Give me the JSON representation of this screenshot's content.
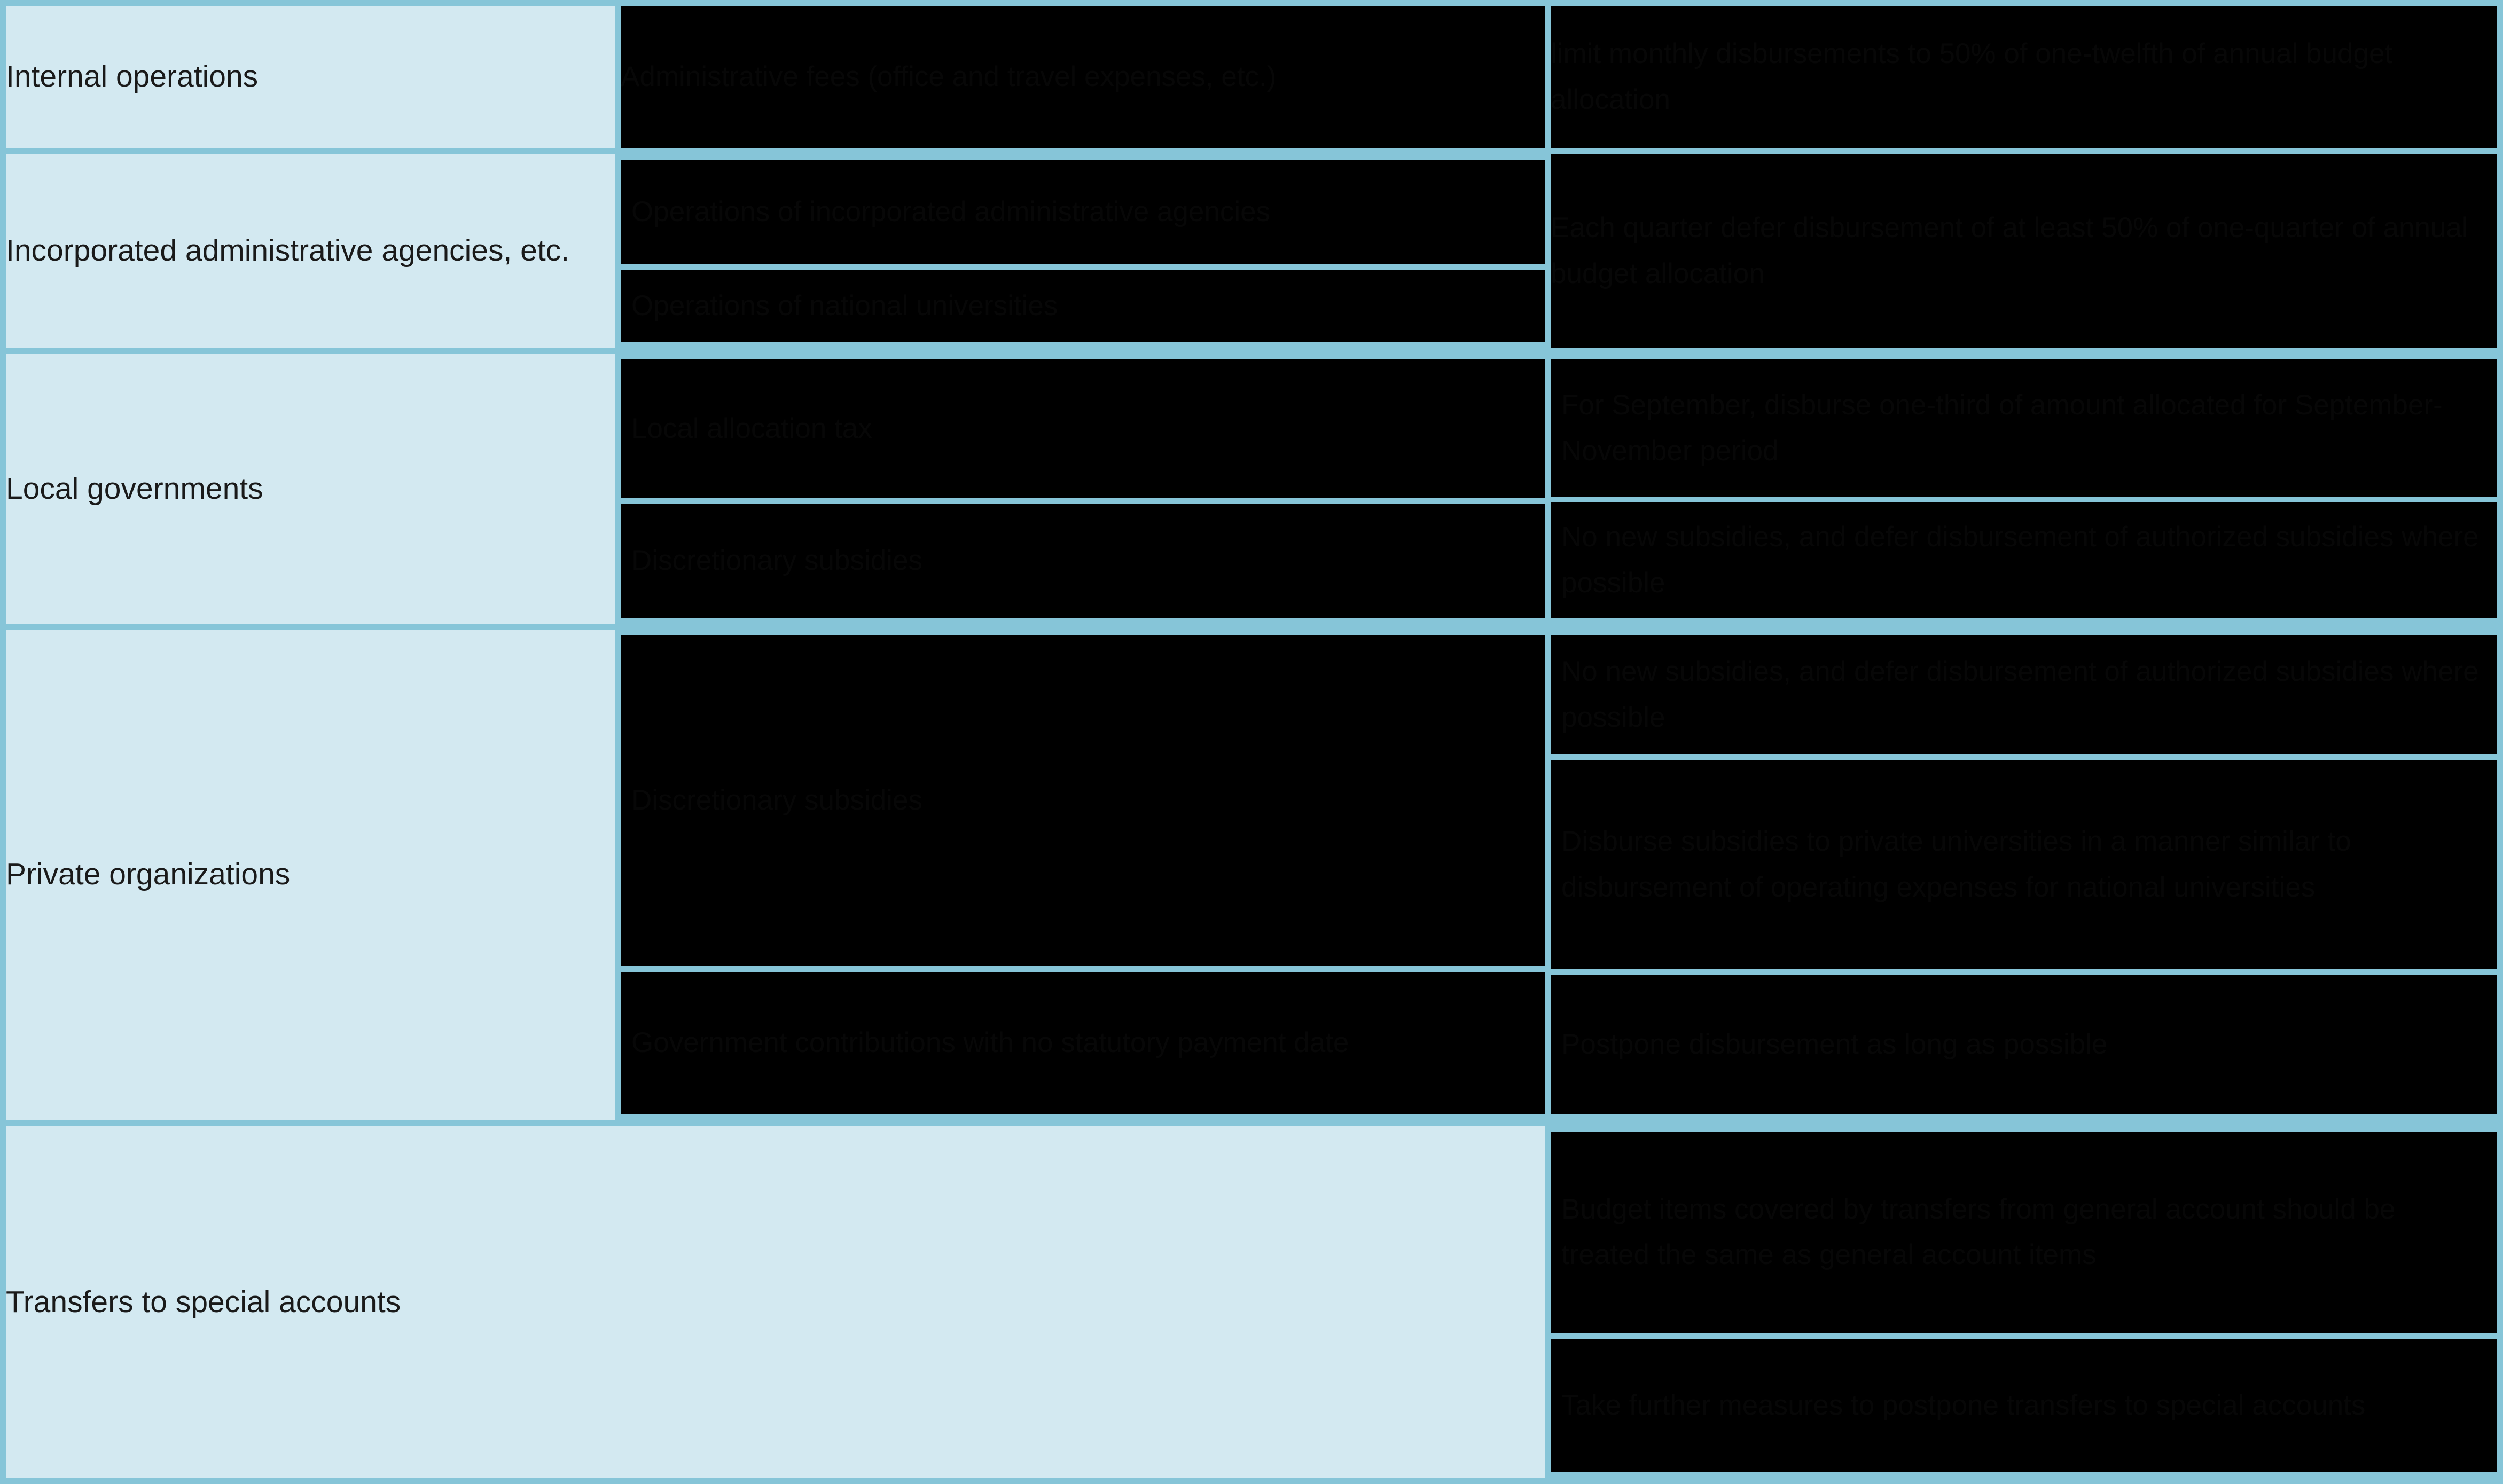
{
  "table": {
    "accent_border_color": "#86c5d8",
    "label_cell_color": "#d3e9f1",
    "body_cell_color": "#000000",
    "rows": [
      {
        "category": "Internal operations",
        "items": [
          {
            "subject": "Administrative fees (office and travel expenses, etc.)",
            "measure": "limit monthly disbursements to 50% of one-twelfth of annual budget allocation"
          }
        ]
      },
      {
        "category": "Incorporated administrative agencies, etc.",
        "items": [
          {
            "subject": "Operations of incorporated administrative agencies",
            "measure": "Each quarter defer disbursement of at least 50% of one-quarter of annual budget allocation"
          },
          {
            "subject": "Operations of national universities",
            "measure": ""
          }
        ]
      },
      {
        "category": "Local governments",
        "items": [
          {
            "subject": "Local allocation tax",
            "measure": "For September, disburse one-third of amount allocated for September-November period"
          },
          {
            "subject": "Discretionary subsidies",
            "measure": "No new subsidies, and defer disbursement of authorized subsidies where possible"
          }
        ]
      },
      {
        "category": "Private organizations",
        "items": [
          {
            "subject": "Discretionary subsidies",
            "measure": "No new subsidies, and defer disbursement of authorized subsidies where possible"
          },
          {
            "subject": "",
            "measure": "Disburse subsidies to private universities in a manner similar to disbursement of operating expenses for national universities"
          },
          {
            "subject": "Government contributions with no statutory payment date",
            "measure": "Postpone disbursement as long as possible"
          }
        ]
      },
      {
        "category": "Transfers to special accounts",
        "items": [
          {
            "subject": "",
            "measure": "Budget items covered by transfers from general account should be treated the same as general account items"
          },
          {
            "subject": "",
            "measure": "Take further measures to postpone transfers to special accounts"
          }
        ]
      }
    ]
  }
}
